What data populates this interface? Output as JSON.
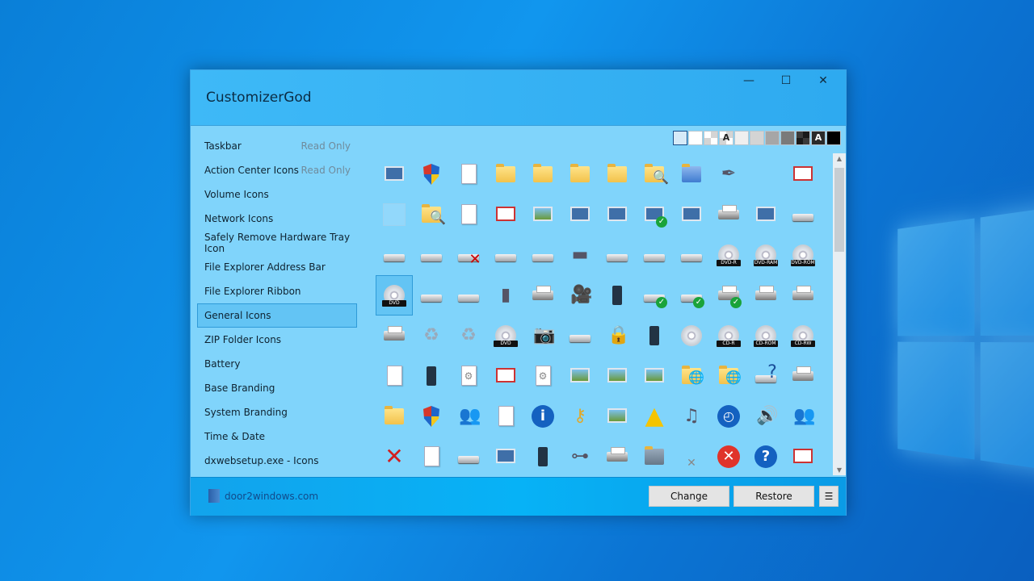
{
  "window": {
    "title": "CustomizerGod",
    "minimize": "—",
    "maximize": "☐",
    "close": "✕"
  },
  "sidebar": {
    "items": [
      {
        "label": "Taskbar",
        "badge": "Read Only"
      },
      {
        "label": "Action Center Icons",
        "badge": "Read Only"
      },
      {
        "label": "Volume Icons"
      },
      {
        "label": "Network Icons"
      },
      {
        "label": "Safely Remove Hardware Tray Icon"
      },
      {
        "label": "File Explorer Address Bar"
      },
      {
        "label": "File Explorer Ribbon"
      },
      {
        "label": "General Icons",
        "selected": true
      },
      {
        "label": "ZIP Folder Icons"
      },
      {
        "label": "Battery"
      },
      {
        "label": "Base Branding"
      },
      {
        "label": "System Branding"
      },
      {
        "label": "Time & Date"
      },
      {
        "label": "dxwebsetup.exe - Icons"
      }
    ]
  },
  "background_swatches": [
    {
      "color": "#d6eaf8",
      "selected": true
    },
    {
      "color": "#ffffff"
    },
    {
      "color": "checker-light"
    },
    {
      "color": "checker-light",
      "text": "A"
    },
    {
      "color": "#efefef"
    },
    {
      "color": "#d4d4d4"
    },
    {
      "color": "#a6a6a6"
    },
    {
      "color": "#7a7a7a"
    },
    {
      "color": "checker-dark"
    },
    {
      "color": "#2a2a2a",
      "text": "A"
    },
    {
      "color": "#000000"
    }
  ],
  "icons": [
    "display-adapter",
    "uac-shield",
    "blank-document",
    "folder",
    "folder",
    "folder",
    "folder-narrow",
    "search-folder",
    "blue-folder",
    "pen",
    "empty",
    "window",
    "empty-square",
    "folder-search",
    "text-document",
    "envelope",
    "picture",
    "music-sheet",
    "film",
    "monitor-check",
    "globe-monitor",
    "printer-folder",
    "control-panel",
    "floppy-drive",
    "drive",
    "drive-cd",
    "drive-removed",
    "drive",
    "drive-green",
    "chip",
    "drive",
    "drive-windows",
    "dvd-drive",
    {
      "name": "disc",
      "label": "DVD-R"
    },
    {
      "name": "disc",
      "label": "DVD-RAM"
    },
    {
      "name": "disc",
      "label": "DVD-ROM"
    },
    {
      "name": "disc",
      "label": "DVD",
      "selected": true
    },
    "drive-floppy",
    "drive-floppy",
    "server",
    "printer-globe",
    "camcorder",
    "phone",
    "drive-check",
    "drive-check",
    "printer-check",
    "printer",
    "printer",
    "printer-stack",
    "recycle-bin-full",
    "recycle-bin-empty",
    {
      "name": "disc",
      "label": "DVD"
    },
    "camera",
    "drive",
    "lock",
    "sd-card",
    {
      "name": "disc"
    },
    {
      "name": "disc",
      "label": "CD-R"
    },
    {
      "name": "disc",
      "label": "CD-ROM"
    },
    {
      "name": "disc",
      "label": "CD-RW"
    },
    "notebook",
    "mp3-player",
    "gear-document",
    "gear-window",
    "gears-document",
    "photo",
    "photo",
    "landscape",
    "folder-globe",
    "folder-globe",
    "help-drive",
    "fax",
    "font-folder",
    "uac-shield",
    "users",
    "checklist",
    "info",
    "key",
    "photo-flower",
    "warning",
    "music-cd",
    "clock-sync",
    "speaker",
    "users",
    "red-x",
    "text-document",
    "drive",
    "panel",
    "phone",
    "ir-device",
    "scanner",
    "gray-folder",
    "small-x",
    "error",
    "help",
    "window-transparent"
  ],
  "footer": {
    "brand": "door2windows.com",
    "change": "Change",
    "restore": "Restore",
    "menu": "☰"
  }
}
